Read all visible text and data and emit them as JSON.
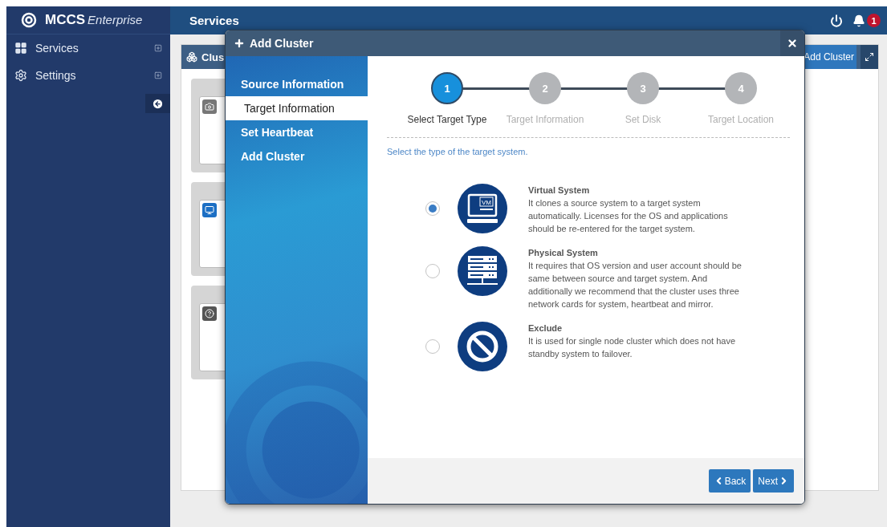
{
  "app": {
    "logo_bold": "MCCS",
    "logo_italic": "Enterprise"
  },
  "header": {
    "title": "Services",
    "notification_count": "1"
  },
  "sidebar": {
    "items": [
      {
        "kind": "grid",
        "label": "Services"
      },
      {
        "kind": "gear",
        "label": "Settings"
      }
    ]
  },
  "panel": {
    "title": "Clus",
    "add_button": "Add Cluster"
  },
  "cards": [
    {
      "kind": "camera"
    },
    {
      "kind": "monitor"
    },
    {
      "kind": "question"
    }
  ],
  "dialog": {
    "title": "Add Cluster",
    "nav": [
      {
        "label": "Source Information",
        "selected": false
      },
      {
        "label": "Target Information",
        "selected": true
      },
      {
        "label": "Set Heartbeat",
        "selected": false
      },
      {
        "label": "Add Cluster",
        "selected": false
      }
    ],
    "steps": [
      {
        "number": "1",
        "label": "Select Target Type",
        "selected": true
      },
      {
        "number": "2",
        "label": "Target Information",
        "selected": false
      },
      {
        "number": "3",
        "label": "Set Disk",
        "selected": false
      },
      {
        "number": "4",
        "label": "Target Location",
        "selected": false
      }
    ],
    "instruction": "Select the type of the target system.",
    "options": [
      {
        "kind": "virtual",
        "icon_text": "VM",
        "title": "Virtual System",
        "description": "It clones a source system to a target system automatically. Licenses for the OS and applications should be re-entered for the target system.",
        "selected": true
      },
      {
        "kind": "physical",
        "title": "Physical System",
        "description": "It requires that OS version and user account should be same between source and target system. And additionally we recommend that the cluster uses three network cards for system, heartbeat and mirror.",
        "selected": false
      },
      {
        "kind": "exclude",
        "title": "Exclude",
        "description": "It is used for single node cluster which does not have standby system to failover.",
        "selected": false
      }
    ],
    "back_button": "Back",
    "next_button": "Next"
  }
}
